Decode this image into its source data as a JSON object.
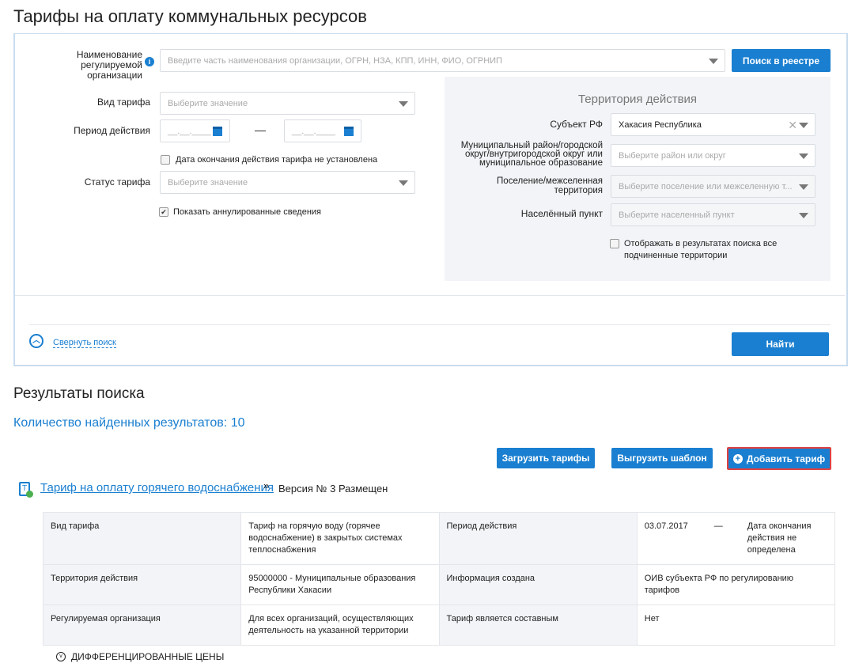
{
  "page_title": "Тарифы на оплату коммунальных ресурсов",
  "search": {
    "org_label": "Наименование регулируемой организации",
    "org_placeholder": "Введите часть наименования организации, ОГРН, НЗА, КПП, ИНН, ФИО, ОГРНИП",
    "registry_button": "Поиск в реестре",
    "tariff_type_label": "Вид тарифа",
    "tariff_type_placeholder": "Выберите значение",
    "period_label": "Период действия",
    "date_placeholder": "__.__.____",
    "period_dash": "—",
    "no_end_date_label": "Дата окончания действия тарифа не установлена",
    "status_label": "Статус тарифа",
    "status_placeholder": "Выберите значение",
    "show_annulled_label": "Показать аннулированные сведения",
    "collapse_label": "Свернуть поиск",
    "find_button": "Найти"
  },
  "territory": {
    "heading": "Территория действия",
    "subject_label": "Субъект РФ",
    "subject_value": "Хакасия Республика",
    "district_label": "Муниципальный район/городской округ/внутригородской округ или муниципальное образование",
    "district_placeholder": "Выберите район или округ",
    "settlement_label": "Поселение/межселенная территория",
    "settlement_placeholder": "Выберите поселение или межселенную т...",
    "locality_label": "Населённый пункт",
    "locality_placeholder": "Выберите населенный пункт",
    "subordinate_label": "Отображать в результатах поиска все подчиненные территории"
  },
  "results": {
    "heading": "Результаты поиска",
    "count": "Количество найденных результатов: 10",
    "upload_button": "Загрузить тарифы",
    "template_button": "Выгрузить шаблон",
    "add_button": "Добавить тариф",
    "tariff_link": "Тариф на оплату горячего водоснабжения",
    "version": "Версия № 3 Размещен",
    "rows": [
      [
        "Вид тарифа",
        "Тариф на горячую воду (горячее водоснабжение) в закрытых системах теплоснабжения",
        "Период действия",
        "03.07.2017"
      ],
      [
        "Территория действия",
        "95000000 - Муниципальные образования Республики Хакасии",
        "Информация создана",
        "ОИВ субъекта РФ по регулированию тарифов"
      ],
      [
        "Регулируемая организация",
        "Для всех организаций, осуществляющих деятельность на указанной территории",
        "Тариф является составным",
        "Нет"
      ]
    ],
    "period_dash": "—",
    "period_end": "Дата окончания действия не определена",
    "diff_prices": "ДИФФЕРЕНЦИРОВАННЫЕ ЦЕНЫ"
  },
  "colors": {
    "accent": "#1a7fd0",
    "highlight": "#e04040"
  }
}
